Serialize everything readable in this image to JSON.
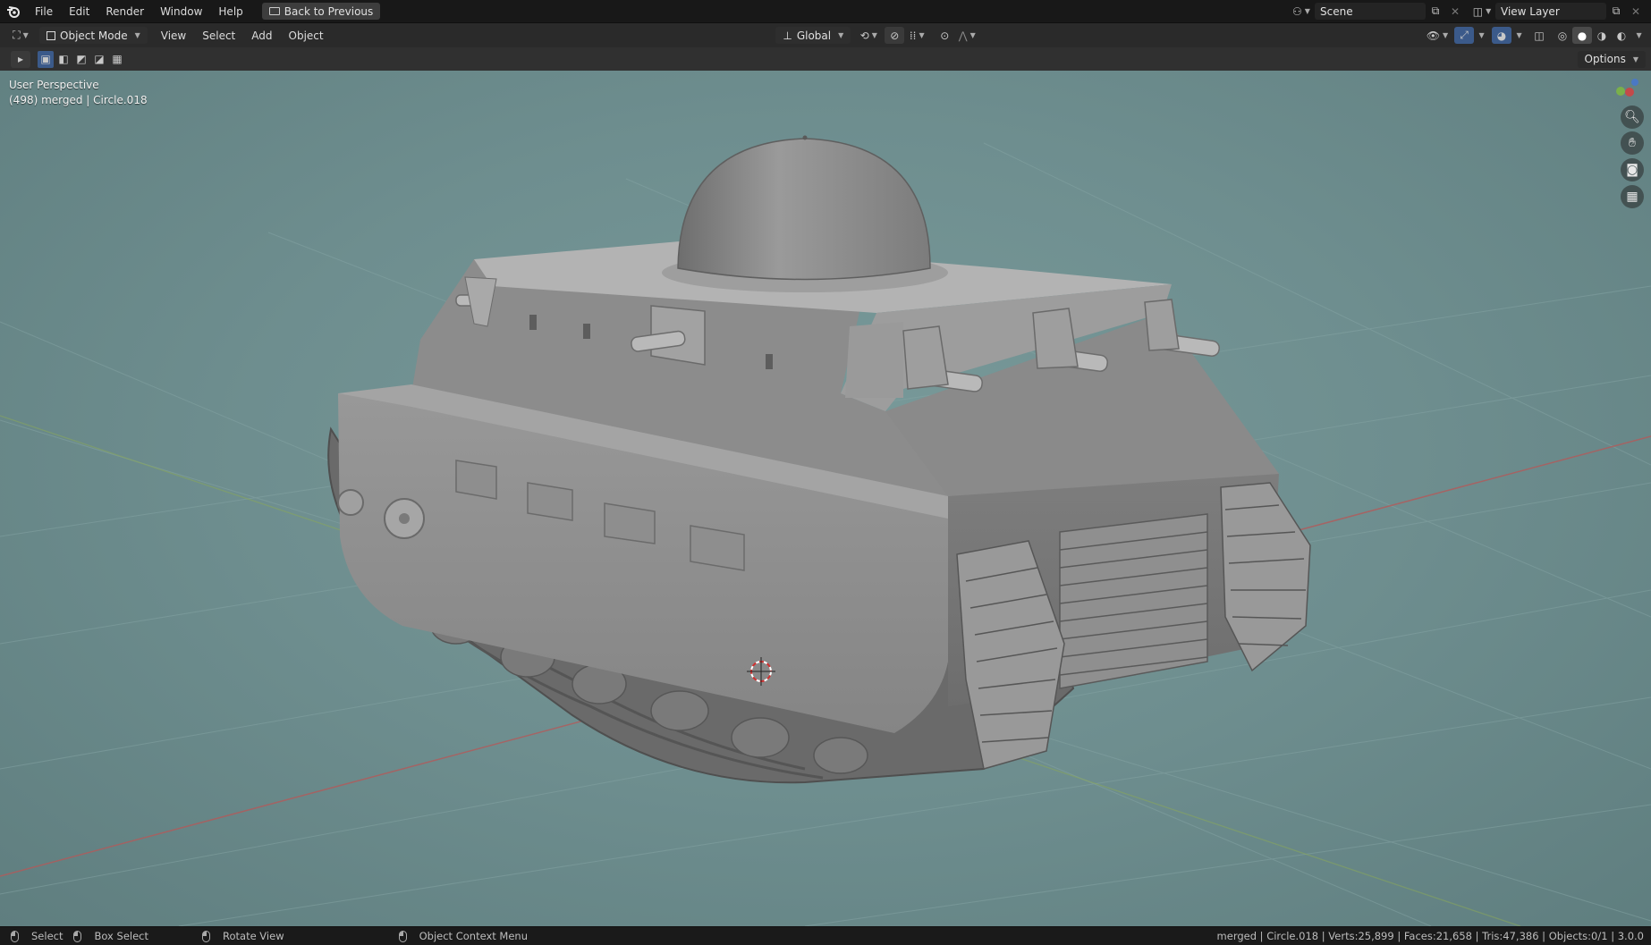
{
  "topbar": {
    "menus": [
      "File",
      "Edit",
      "Render",
      "Window",
      "Help"
    ],
    "back_button": "Back to Previous",
    "scene": "Scene",
    "view_layer": "View Layer"
  },
  "header": {
    "mode": "Object Mode",
    "menus": [
      "View",
      "Select",
      "Add",
      "Object"
    ],
    "transform_orientation": "Global"
  },
  "toolrow": {
    "options": "Options"
  },
  "viewport": {
    "perspective": "User Perspective",
    "object_info": "(498) merged | Circle.018",
    "background_color": "#6e8e8f"
  },
  "statusbar": {
    "select": "Select",
    "box_select": "Box Select",
    "rotate_view": "Rotate View",
    "context_menu": "Object Context Menu",
    "stats": "merged | Circle.018 | Verts:25,899 | Faces:21,658 | Tris:47,386 | Objects:0/1 | 3.0.0"
  },
  "icons": {
    "blender_logo": "blender-icon",
    "navigation": [
      "zoom-icon",
      "pan-hand-icon",
      "camera-icon",
      "grid-ortho-icon"
    ]
  }
}
